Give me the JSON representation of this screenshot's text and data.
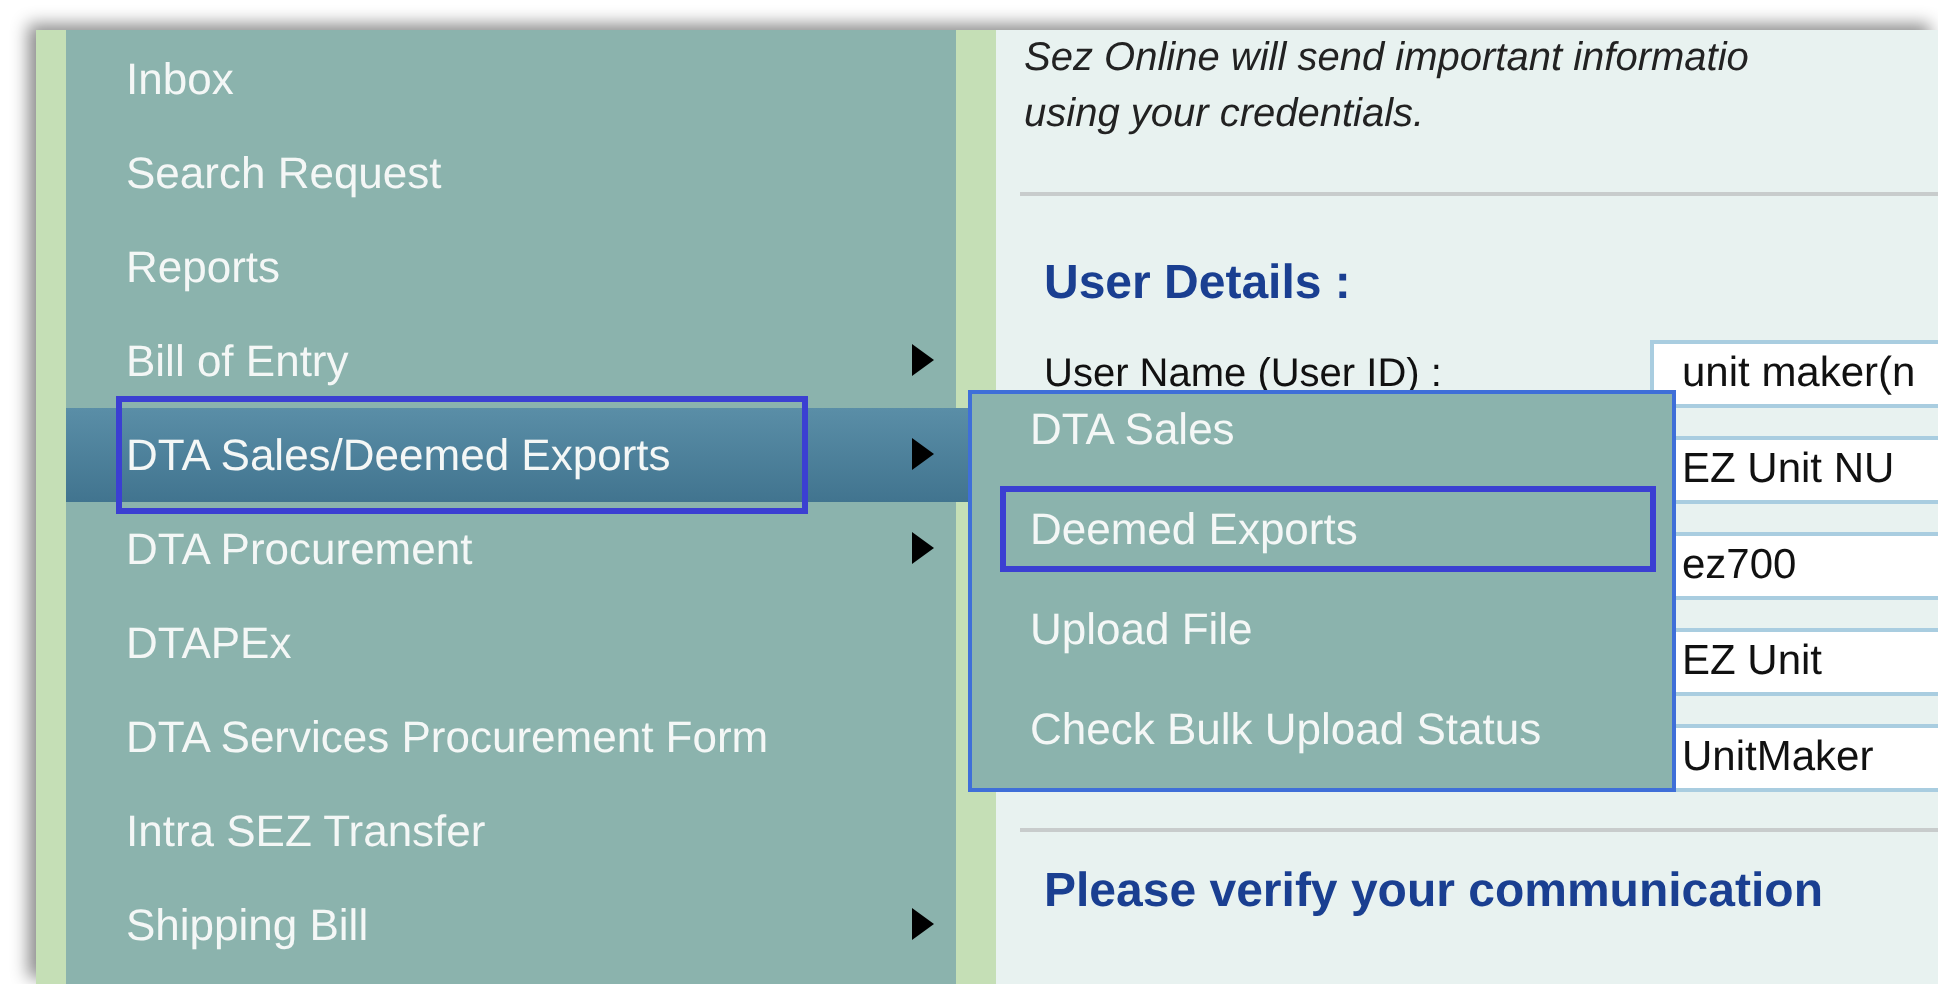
{
  "sidebar": {
    "items": [
      {
        "label": "Inbox",
        "has_submenu": false,
        "selected": false,
        "annotated": false
      },
      {
        "label": "Search Request",
        "has_submenu": false,
        "selected": false,
        "annotated": false
      },
      {
        "label": "Reports",
        "has_submenu": false,
        "selected": false,
        "annotated": false
      },
      {
        "label": "Bill of Entry",
        "has_submenu": true,
        "selected": false,
        "annotated": false
      },
      {
        "label": "DTA Sales/Deemed Exports",
        "has_submenu": true,
        "selected": true,
        "annotated": true
      },
      {
        "label": "DTA Procurement",
        "has_submenu": true,
        "selected": false,
        "annotated": false
      },
      {
        "label": "DTAPEx",
        "has_submenu": false,
        "selected": false,
        "annotated": false
      },
      {
        "label": "DTA Services Procurement Form",
        "has_submenu": false,
        "selected": false,
        "annotated": false
      },
      {
        "label": "Intra SEZ Transfer",
        "has_submenu": false,
        "selected": false,
        "annotated": false
      },
      {
        "label": "Shipping Bill",
        "has_submenu": true,
        "selected": false,
        "annotated": false
      }
    ]
  },
  "submenu": {
    "items": [
      {
        "label": "DTA Sales",
        "annotated": false
      },
      {
        "label": "Deemed Exports",
        "annotated": true
      },
      {
        "label": "Upload File",
        "annotated": false
      },
      {
        "label": "Check Bulk Upload Status",
        "annotated": false
      }
    ]
  },
  "content": {
    "notice_lines": [
      "Sez Online will send important informatio",
      "using your credentials."
    ],
    "section_title": "User Details :",
    "fields": [
      {
        "label": "User Name (User ID) :",
        "value": "unit maker(n"
      },
      {
        "value": "EZ Unit NU"
      },
      {
        "value": "ez700"
      },
      {
        "value": "EZ Unit"
      },
      {
        "value": "UnitMaker"
      }
    ],
    "next_section_title": "Please verify your communication"
  }
}
